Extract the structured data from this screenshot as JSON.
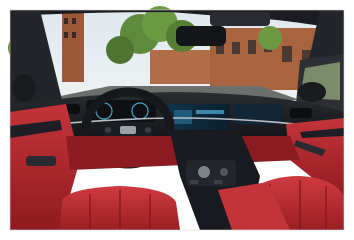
{
  "scene": {
    "subject": "car-interior-red-leather",
    "colors": {
      "frame": "#ffffff",
      "sky": "#e6ecf0",
      "trees": "#5f8a3c",
      "brick": "#a8643f",
      "road": "#6d6f6c",
      "dash": "#1b1d22",
      "leather": "#b3262b",
      "leather_dark": "#7d1619",
      "chrome": "#b8bec4",
      "screen": "#0d2a3c"
    }
  }
}
